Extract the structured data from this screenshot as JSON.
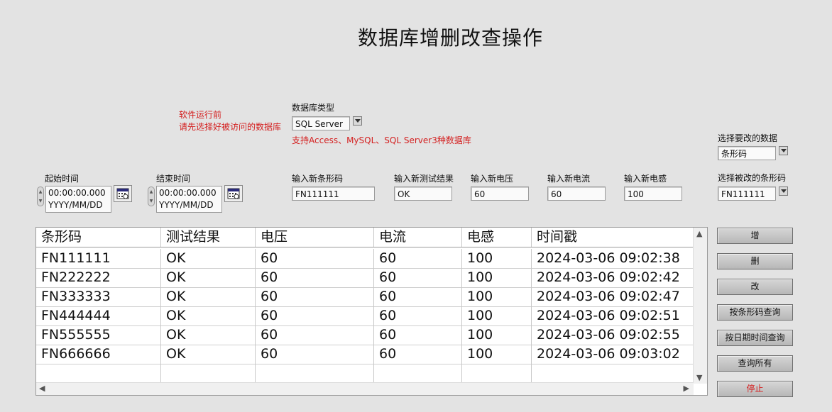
{
  "title": "数据库增删改查操作",
  "notes": {
    "line1": "软件运行前",
    "line2": "请先选择好被访问的数据库",
    "support": "支持Access、MySQL、SQL Server3种数据库"
  },
  "db_type": {
    "label": "数据库类型",
    "value": "SQL Server"
  },
  "select_modify": {
    "label": "选择要改的数据",
    "value": "条形码"
  },
  "select_barcode": {
    "label": "选择被改的条形码",
    "value": "FN111111"
  },
  "start_time": {
    "label": "起始时间",
    "time": "00:00:00.000",
    "date": "YYYY/MM/DD"
  },
  "end_time": {
    "label": "结束时间",
    "time": "00:00:00.000",
    "date": "YYYY/MM/DD"
  },
  "inputs": {
    "barcode": {
      "label": "输入新条形码",
      "value": "FN111111"
    },
    "result": {
      "label": "输入新测试结果",
      "value": "OK"
    },
    "voltage": {
      "label": "输入新电压",
      "value": "60"
    },
    "current": {
      "label": "输入新电流",
      "value": "60"
    },
    "inductance": {
      "label": "输入新电感",
      "value": "100"
    }
  },
  "table": {
    "columns": [
      "条形码",
      "测试结果",
      "电压",
      "电流",
      "电感",
      "时间戳"
    ],
    "rows": [
      [
        "FN111111",
        "OK",
        "60",
        "60",
        "100",
        "2024-03-06 09:02:38"
      ],
      [
        "FN222222",
        "OK",
        "60",
        "60",
        "100",
        "2024-03-06 09:02:42"
      ],
      [
        "FN333333",
        "OK",
        "60",
        "60",
        "100",
        "2024-03-06 09:02:47"
      ],
      [
        "FN444444",
        "OK",
        "60",
        "60",
        "100",
        "2024-03-06 09:02:51"
      ],
      [
        "FN555555",
        "OK",
        "60",
        "60",
        "100",
        "2024-03-06 09:02:55"
      ],
      [
        "FN666666",
        "OK",
        "60",
        "60",
        "100",
        "2024-03-06 09:03:02"
      ]
    ]
  },
  "buttons": {
    "add": "增",
    "delete": "删",
    "modify": "改",
    "query_barcode": "按条形码查询",
    "query_datetime": "按日期时间查询",
    "query_all": "查询所有",
    "stop": "停止"
  },
  "colors": {
    "note_red": "#d42020",
    "background": "#e3e3e3"
  },
  "icons": {
    "calendar": "calendar-icon",
    "dropdown": "chevron-down-icon",
    "spinner": "spinner-icon"
  }
}
